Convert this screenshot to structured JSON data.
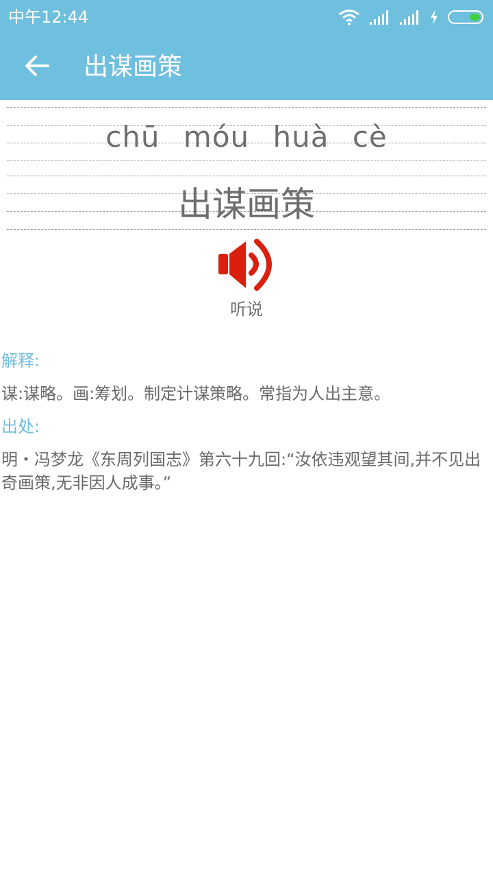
{
  "status_bar": {
    "time": "中午12:44",
    "icons": [
      "wifi-icon",
      "signal-icon",
      "signal-icon",
      "charging-icon",
      "battery-icon"
    ]
  },
  "app_bar": {
    "title": "出谋画策",
    "back_icon": "back-arrow-icon"
  },
  "hero": {
    "pinyin": [
      "chū",
      "móu",
      "huà",
      "cè"
    ],
    "idiom": "出谋画策"
  },
  "audio": {
    "label": "听说",
    "icon": "speaker-icon"
  },
  "definition": {
    "heading": "解释:",
    "text": "谋:谋略。画:筹划。制定计谋策略。常指为人出主意。"
  },
  "source": {
    "heading": "出处:",
    "text": "明・冯梦龙《东周列国志》第六十九回:“汝依违观望其间,并不见出奇画策,无非因人成事。”"
  },
  "colors": {
    "accent": "#6fbfde",
    "text": "#6a6a6a",
    "speaker": "#d9200f"
  }
}
